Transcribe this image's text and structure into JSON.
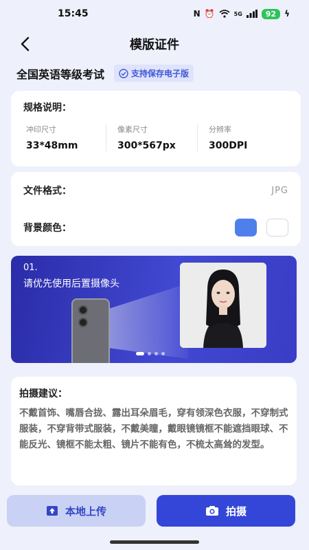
{
  "status_bar": {
    "time": "15:45",
    "nfc": "N",
    "network": "5G",
    "battery": "92"
  },
  "nav": {
    "title": "模版证件"
  },
  "exam": {
    "title": "全国英语等级考试",
    "tag": "支持保存电子版"
  },
  "spec": {
    "heading": "规格说明：",
    "items": [
      {
        "label": "冲印尺寸",
        "value": "33*48mm"
      },
      {
        "label": "像素尺寸",
        "value": "300*567px"
      },
      {
        "label": "分辨率",
        "value": "300DPI"
      }
    ]
  },
  "format": {
    "file_label": "文件格式：",
    "file_value": "JPG",
    "bg_label": "背景颜色：",
    "bg_colors": [
      "#4f7fea",
      "#ffffff"
    ]
  },
  "banner": {
    "step": "01.",
    "text": "请优先使用后置摄像头",
    "slide_index": 1,
    "slide_count": 4
  },
  "tips": {
    "title": "拍摄建议：",
    "text": "不戴首饰、嘴唇合拢、露出耳朵眉毛，穿有领深色衣服，不穿制式服装，不穿背带式服装，不戴美瞳，戴眼镜镜框不能遮挡眼球、不能反光、镜框不能太粗、镜片不能有色，不梳太高耸的发型。"
  },
  "actions": {
    "upload_label": "本地上传",
    "shoot_label": "拍摄"
  },
  "colors": {
    "accent": "#3346d8",
    "tag_bg": "#dfe3fb",
    "page_bg": "#eef0fb"
  },
  "icons": {
    "back": "chevron-left-icon",
    "tag": "check-circle-icon",
    "upload": "upload-icon",
    "camera": "camera-icon"
  }
}
